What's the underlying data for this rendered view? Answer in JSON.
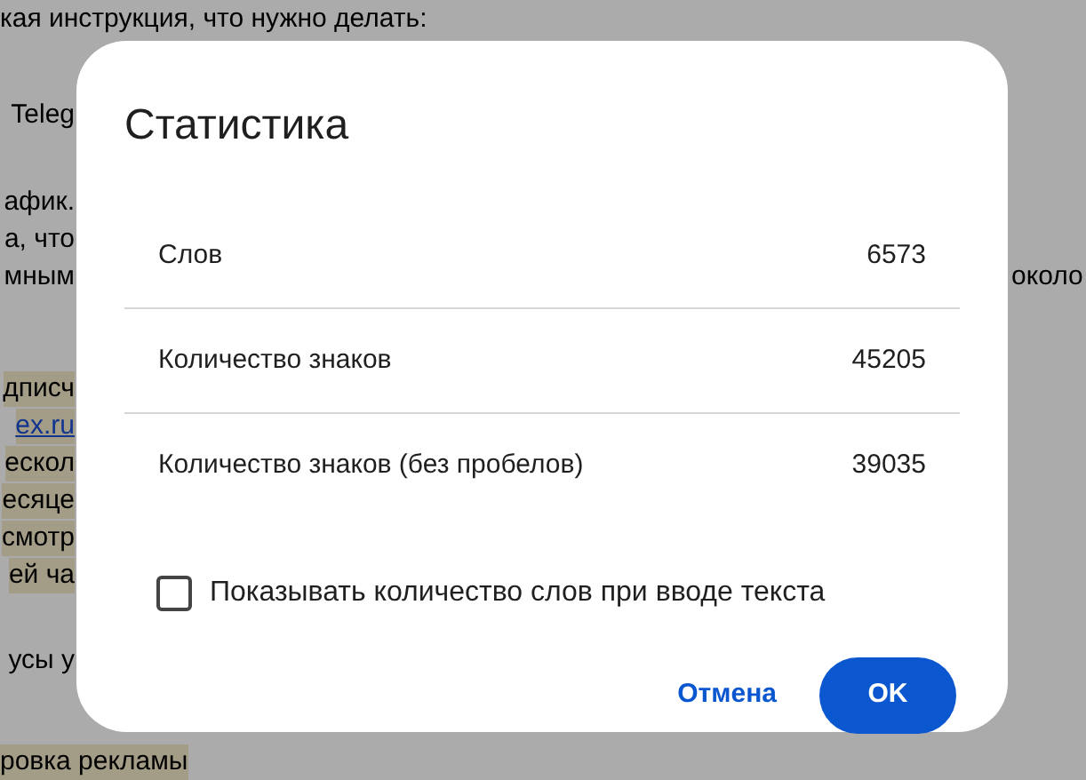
{
  "document": {
    "lines": [
      {
        "text": "кая инструкция, что нужно делать:",
        "kind": "text",
        "highlight": false
      },
      {
        "text": "Teleg",
        "kind": "text",
        "highlight": false
      },
      {
        "text": "афик.",
        "kind": "text",
        "highlight": false
      },
      {
        "text": "а, что",
        "kind": "text",
        "highlight": false
      },
      {
        "text": "мным",
        "kind": "text",
        "highlight": false
      },
      {
        "text": "около",
        "kind": "text",
        "highlight": false
      },
      {
        "text": "дписч",
        "kind": "text",
        "highlight": true
      },
      {
        "text": "ex.ru",
        "kind": "link",
        "highlight": true
      },
      {
        "text": "ескол",
        "kind": "text",
        "highlight": true
      },
      {
        "text": "есяце",
        "kind": "text",
        "highlight": true
      },
      {
        "text": "смотр",
        "kind": "text",
        "highlight": true
      },
      {
        "text": "ей ча",
        "kind": "text",
        "highlight": true
      },
      {
        "text": "усы у",
        "kind": "text",
        "highlight": false
      },
      {
        "text": "ровка рекламы",
        "kind": "text",
        "highlight": true
      }
    ]
  },
  "dialog": {
    "title": "Статистика",
    "stats": [
      {
        "label": "Слов",
        "value": "6573"
      },
      {
        "label": "Количество знаков",
        "value": "45205"
      },
      {
        "label": "Количество знаков (без пробелов)",
        "value": "39035"
      }
    ],
    "checkbox": {
      "label": "Показывать количество слов при вводе текста",
      "checked": false
    },
    "buttons": [
      {
        "label": "Отмена",
        "kind": "text"
      },
      {
        "label": "OK",
        "kind": "filled"
      }
    ]
  }
}
